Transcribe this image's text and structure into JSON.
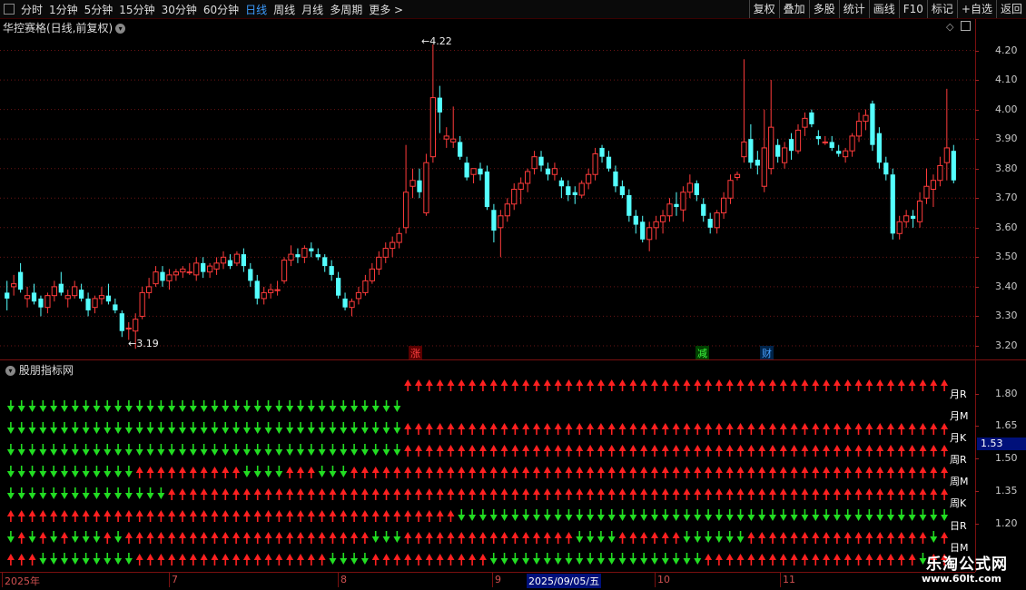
{
  "toolbar": {
    "periods": [
      "分时",
      "1分钟",
      "5分钟",
      "15分钟",
      "30分钟",
      "60分钟",
      "日线",
      "周线",
      "月线",
      "多周期",
      "更多 >"
    ],
    "active_period": "日线",
    "buttons": [
      "复权",
      "叠加",
      "多股",
      "统计",
      "画线",
      "F10",
      "标记",
      "+自选",
      "返回"
    ]
  },
  "main_pane": {
    "title": "华控赛格(日线,前复权)",
    "y_ticks": [
      "4.20",
      "4.10",
      "4.00",
      "3.90",
      "3.80",
      "3.70",
      "3.60",
      "3.50",
      "3.40",
      "3.30",
      "3.20"
    ],
    "high_label": "4.22",
    "low_label": "3.19",
    "markers": [
      {
        "text": "涨",
        "color": "#ff4040",
        "bg": "#5a0000"
      },
      {
        "text": "减",
        "color": "#40ff40",
        "bg": "#004000"
      },
      {
        "text": "财",
        "color": "#4aa0ff",
        "bg": "#00244a"
      }
    ]
  },
  "indicator_pane": {
    "title": "股朋指标网",
    "y_ticks": [
      "1.80",
      "1.65",
      "1.50",
      "1.35",
      "1.20"
    ],
    "current_value": "1.53",
    "row_labels": [
      "月R",
      "月M",
      "月K",
      "周R",
      "周M",
      "周K",
      "日R",
      "日M"
    ]
  },
  "date_axis": {
    "labels": [
      "2025年",
      "7",
      "8",
      "9",
      "2025/09/05/五",
      "10",
      "11"
    ]
  },
  "watermark": {
    "line1": "乐淘公式网",
    "line2": "www.60lt.com"
  },
  "chart_data": {
    "type": "candlestick",
    "title": "华控赛格(日线,前复权)",
    "ylim": [
      3.16,
      4.26
    ],
    "up_color": "#ff3b3b",
    "down_color": "#54ffff",
    "candles": [
      [
        3.38,
        3.42,
        3.32,
        3.36
      ],
      [
        3.4,
        3.44,
        3.37,
        3.41
      ],
      [
        3.45,
        3.48,
        3.38,
        3.39
      ],
      [
        3.36,
        3.4,
        3.33,
        3.37
      ],
      [
        3.38,
        3.41,
        3.34,
        3.35
      ],
      [
        3.36,
        3.37,
        3.3,
        3.33
      ],
      [
        3.33,
        3.38,
        3.31,
        3.37
      ],
      [
        3.37,
        3.42,
        3.35,
        3.4
      ],
      [
        3.41,
        3.45,
        3.37,
        3.38
      ],
      [
        3.36,
        3.39,
        3.33,
        3.37
      ],
      [
        3.37,
        3.42,
        3.36,
        3.4
      ],
      [
        3.39,
        3.41,
        3.35,
        3.36
      ],
      [
        3.36,
        3.38,
        3.3,
        3.32
      ],
      [
        3.33,
        3.37,
        3.31,
        3.36
      ],
      [
        3.36,
        3.4,
        3.34,
        3.37
      ],
      [
        3.37,
        3.41,
        3.34,
        3.35
      ],
      [
        3.34,
        3.36,
        3.31,
        3.32
      ],
      [
        3.31,
        3.32,
        3.23,
        3.25
      ],
      [
        3.26,
        3.28,
        3.22,
        3.26
      ],
      [
        3.25,
        3.31,
        3.19,
        3.29
      ],
      [
        3.3,
        3.4,
        3.29,
        3.38
      ],
      [
        3.38,
        3.43,
        3.36,
        3.4
      ],
      [
        3.41,
        3.47,
        3.4,
        3.45
      ],
      [
        3.45,
        3.47,
        3.4,
        3.42
      ],
      [
        3.42,
        3.46,
        3.39,
        3.44
      ],
      [
        3.44,
        3.46,
        3.42,
        3.45
      ],
      [
        3.45,
        3.47,
        3.43,
        3.46
      ],
      [
        3.45,
        3.48,
        3.44,
        3.45
      ],
      [
        3.44,
        3.5,
        3.42,
        3.48
      ],
      [
        3.48,
        3.5,
        3.43,
        3.45
      ],
      [
        3.45,
        3.48,
        3.43,
        3.47
      ],
      [
        3.46,
        3.5,
        3.44,
        3.48
      ],
      [
        3.48,
        3.52,
        3.46,
        3.5
      ],
      [
        3.49,
        3.51,
        3.46,
        3.47
      ],
      [
        3.48,
        3.52,
        3.47,
        3.51
      ],
      [
        3.51,
        3.53,
        3.45,
        3.47
      ],
      [
        3.46,
        3.48,
        3.4,
        3.42
      ],
      [
        3.42,
        3.44,
        3.34,
        3.36
      ],
      [
        3.36,
        3.4,
        3.34,
        3.38
      ],
      [
        3.38,
        3.41,
        3.36,
        3.39
      ],
      [
        3.39,
        3.42,
        3.37,
        3.39
      ],
      [
        3.42,
        3.5,
        3.41,
        3.49
      ],
      [
        3.49,
        3.54,
        3.47,
        3.51
      ],
      [
        3.51,
        3.53,
        3.48,
        3.5
      ],
      [
        3.5,
        3.54,
        3.48,
        3.53
      ],
      [
        3.53,
        3.55,
        3.5,
        3.52
      ],
      [
        3.51,
        3.53,
        3.49,
        3.5
      ],
      [
        3.5,
        3.51,
        3.45,
        3.47
      ],
      [
        3.47,
        3.49,
        3.42,
        3.44
      ],
      [
        3.43,
        3.45,
        3.36,
        3.37
      ],
      [
        3.36,
        3.38,
        3.32,
        3.33
      ],
      [
        3.33,
        3.36,
        3.3,
        3.35
      ],
      [
        3.36,
        3.4,
        3.34,
        3.38
      ],
      [
        3.38,
        3.44,
        3.37,
        3.42
      ],
      [
        3.42,
        3.48,
        3.41,
        3.46
      ],
      [
        3.46,
        3.52,
        3.44,
        3.5
      ],
      [
        3.5,
        3.55,
        3.48,
        3.53
      ],
      [
        3.53,
        3.57,
        3.5,
        3.55
      ],
      [
        3.55,
        3.6,
        3.53,
        3.58
      ],
      [
        3.6,
        3.88,
        3.58,
        3.72
      ],
      [
        3.74,
        3.8,
        3.7,
        3.76
      ],
      [
        3.76,
        3.8,
        3.7,
        3.72
      ],
      [
        3.65,
        3.85,
        3.64,
        3.82
      ],
      [
        3.84,
        4.22,
        3.82,
        4.04
      ],
      [
        4.04,
        4.08,
        3.92,
        3.99
      ],
      [
        3.9,
        3.94,
        3.87,
        3.91
      ],
      [
        3.89,
        4.01,
        3.87,
        3.9
      ],
      [
        3.89,
        3.91,
        3.83,
        3.84
      ],
      [
        3.82,
        3.84,
        3.76,
        3.77
      ],
      [
        3.78,
        3.8,
        3.75,
        3.8
      ],
      [
        3.8,
        3.82,
        3.76,
        3.78
      ],
      [
        3.79,
        3.81,
        3.66,
        3.67
      ],
      [
        3.66,
        3.68,
        3.55,
        3.59
      ],
      [
        3.6,
        3.66,
        3.5,
        3.64
      ],
      [
        3.64,
        3.7,
        3.62,
        3.68
      ],
      [
        3.68,
        3.75,
        3.66,
        3.73
      ],
      [
        3.73,
        3.77,
        3.68,
        3.75
      ],
      [
        3.75,
        3.8,
        3.72,
        3.79
      ],
      [
        3.8,
        3.86,
        3.78,
        3.84
      ],
      [
        3.84,
        3.86,
        3.79,
        3.81
      ],
      [
        3.8,
        3.82,
        3.76,
        3.78
      ],
      [
        3.78,
        3.82,
        3.76,
        3.8
      ],
      [
        3.76,
        3.77,
        3.7,
        3.74
      ],
      [
        3.74,
        3.76,
        3.69,
        3.71
      ],
      [
        3.72,
        3.74,
        3.68,
        3.71
      ],
      [
        3.71,
        3.76,
        3.7,
        3.75
      ],
      [
        3.75,
        3.8,
        3.73,
        3.78
      ],
      [
        3.78,
        3.87,
        3.76,
        3.85
      ],
      [
        3.87,
        3.88,
        3.82,
        3.84
      ],
      [
        3.84,
        3.86,
        3.79,
        3.8
      ],
      [
        3.79,
        3.81,
        3.72,
        3.74
      ],
      [
        3.74,
        3.76,
        3.7,
        3.71
      ],
      [
        3.71,
        3.73,
        3.62,
        3.64
      ],
      [
        3.64,
        3.66,
        3.58,
        3.61
      ],
      [
        3.62,
        3.64,
        3.55,
        3.56
      ],
      [
        3.56,
        3.62,
        3.52,
        3.6
      ],
      [
        3.6,
        3.64,
        3.56,
        3.62
      ],
      [
        3.62,
        3.66,
        3.58,
        3.64
      ],
      [
        3.64,
        3.7,
        3.62,
        3.68
      ],
      [
        3.68,
        3.72,
        3.64,
        3.67
      ],
      [
        3.66,
        3.74,
        3.62,
        3.72
      ],
      [
        3.72,
        3.78,
        3.7,
        3.75
      ],
      [
        3.75,
        3.76,
        3.69,
        3.71
      ],
      [
        3.68,
        3.7,
        3.62,
        3.64
      ],
      [
        3.63,
        3.65,
        3.58,
        3.6
      ],
      [
        3.6,
        3.66,
        3.58,
        3.65
      ],
      [
        3.65,
        3.72,
        3.63,
        3.7
      ],
      [
        3.7,
        3.78,
        3.68,
        3.76
      ],
      [
        3.77,
        3.79,
        3.76,
        3.78
      ],
      [
        3.84,
        4.17,
        3.82,
        3.89
      ],
      [
        3.9,
        3.95,
        3.8,
        3.82
      ],
      [
        3.83,
        3.86,
        3.78,
        3.81
      ],
      [
        3.74,
        4.0,
        3.72,
        3.87
      ],
      [
        3.8,
        4.1,
        3.78,
        3.94
      ],
      [
        3.88,
        3.9,
        3.82,
        3.84
      ],
      [
        3.82,
        3.89,
        3.8,
        3.87
      ],
      [
        3.9,
        3.92,
        3.83,
        3.86
      ],
      [
        3.86,
        3.95,
        3.85,
        3.93
      ],
      [
        3.94,
        3.99,
        3.91,
        3.97
      ],
      [
        3.99,
        4.0,
        3.94,
        3.95
      ],
      [
        3.91,
        3.93,
        3.88,
        3.9
      ],
      [
        3.89,
        3.91,
        3.88,
        3.89
      ],
      [
        3.89,
        3.91,
        3.86,
        3.87
      ],
      [
        3.86,
        3.88,
        3.84,
        3.85
      ],
      [
        3.84,
        3.87,
        3.82,
        3.86
      ],
      [
        3.86,
        3.92,
        3.84,
        3.91
      ],
      [
        3.91,
        3.99,
        3.89,
        3.96
      ],
      [
        3.96,
        4.0,
        3.93,
        3.98
      ],
      [
        4.02,
        4.03,
        3.86,
        3.88
      ],
      [
        3.92,
        3.94,
        3.8,
        3.82
      ],
      [
        3.82,
        3.84,
        3.76,
        3.78
      ],
      [
        3.78,
        3.8,
        3.56,
        3.58
      ],
      [
        3.58,
        3.64,
        3.56,
        3.62
      ],
      [
        3.62,
        3.66,
        3.6,
        3.64
      ],
      [
        3.64,
        3.66,
        3.6,
        3.63
      ],
      [
        3.62,
        3.72,
        3.6,
        3.69
      ],
      [
        3.7,
        3.8,
        3.68,
        3.74
      ],
      [
        3.73,
        3.78,
        3.67,
        3.76
      ],
      [
        3.76,
        3.84,
        3.74,
        3.81
      ],
      [
        3.82,
        4.07,
        3.76,
        3.87
      ],
      [
        3.86,
        3.88,
        3.75,
        3.76
      ]
    ]
  }
}
